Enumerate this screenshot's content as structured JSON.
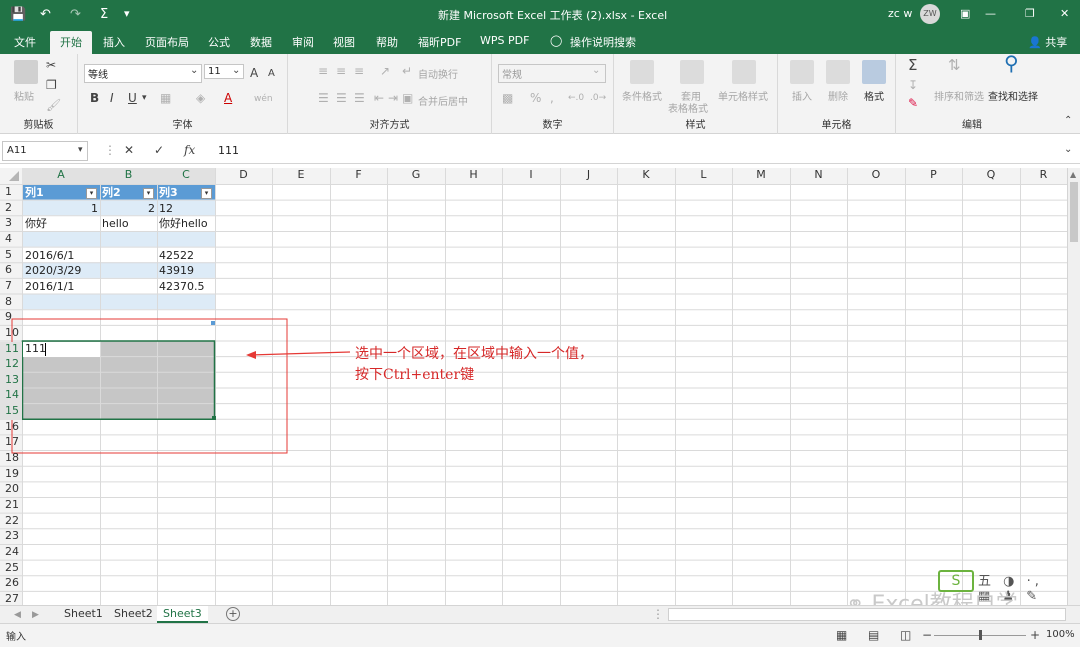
{
  "window": {
    "title": "新建 Microsoft Excel 工作表 (2).xlsx  -  Excel",
    "user": "zc w",
    "avatar": "ZW"
  },
  "tabs": [
    "文件",
    "开始",
    "插入",
    "页面布局",
    "公式",
    "数据",
    "审阅",
    "视图",
    "帮助",
    "福昕PDF",
    "WPS PDF",
    "操作说明搜索",
    "共享"
  ],
  "ribbon": {
    "clipboard": {
      "label": "剪贴板",
      "paste": "粘贴"
    },
    "font": {
      "label": "字体",
      "name": "等线",
      "size": "11",
      "bold": "B",
      "italic": "I",
      "underline": "U",
      "grow": "A",
      "shrink": "A",
      "color_a": "A",
      "wen": "wén"
    },
    "align": {
      "label": "对齐方式",
      "wrap": "自动换行",
      "merge": "合并后居中"
    },
    "number": {
      "label": "数字",
      "format": "常规",
      "percent": "%",
      "comma": ","
    },
    "styles": {
      "label": "样式",
      "cond": "条件格式",
      "table1": "套用",
      "table2": "表格格式",
      "cell": "单元格样式"
    },
    "cells": {
      "label": "单元格",
      "insert": "插入",
      "delete": "删除",
      "format": "格式"
    },
    "edit": {
      "label": "编辑",
      "sort": "排序和筛选",
      "find": "查找和选择"
    }
  },
  "formula": {
    "namebox": "A11",
    "value": "111",
    "fx": "fx"
  },
  "columns": [
    "A",
    "B",
    "C",
    "D",
    "E",
    "F",
    "G",
    "H",
    "I",
    "J",
    "K",
    "L",
    "M",
    "N",
    "O",
    "P",
    "Q",
    "R"
  ],
  "rows": [
    "1",
    "2",
    "3",
    "4",
    "5",
    "6",
    "7",
    "8",
    "9",
    "10",
    "11",
    "12",
    "13",
    "14",
    "15",
    "16",
    "17",
    "18",
    "19",
    "20",
    "21",
    "22",
    "23",
    "24",
    "25",
    "26",
    "27"
  ],
  "table": {
    "headers": [
      "列1",
      "列2",
      "列3"
    ],
    "r2": [
      "1",
      "2",
      "12"
    ],
    "r3": [
      "你好",
      "hello",
      "你好hello"
    ],
    "r5": [
      "2016/6/1",
      "42522"
    ],
    "r6": [
      "2020/3/29",
      "43919"
    ],
    "r7": [
      "2016/1/1",
      "42370.5"
    ]
  },
  "active_cell_value": "111",
  "annotation": {
    "line1": "选中一个区域，在区域中输入一个值，",
    "line2": "按下Ctrl+enter键"
  },
  "sheets": [
    "Sheet1",
    "Sheet2",
    "Sheet3"
  ],
  "status": {
    "mode": "输入",
    "zoom": "100%"
  },
  "watermark": "Excel教程自学",
  "colors": {
    "excel_green": "#217346",
    "table_header": "#5b9bd5",
    "band": "#ddebf7",
    "selection": "#c6c6c6",
    "annotation": "#d62828"
  }
}
